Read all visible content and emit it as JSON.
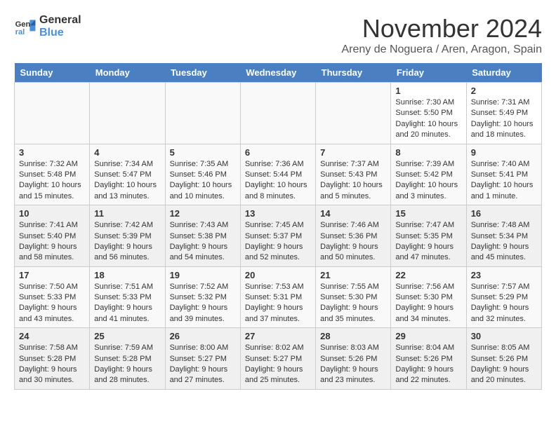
{
  "header": {
    "logo_line1": "General",
    "logo_line2": "Blue",
    "month": "November 2024",
    "location": "Areny de Noguera / Aren, Aragon, Spain"
  },
  "weekdays": [
    "Sunday",
    "Monday",
    "Tuesday",
    "Wednesday",
    "Thursday",
    "Friday",
    "Saturday"
  ],
  "weeks": [
    [
      {
        "day": "",
        "info": ""
      },
      {
        "day": "",
        "info": ""
      },
      {
        "day": "",
        "info": ""
      },
      {
        "day": "",
        "info": ""
      },
      {
        "day": "",
        "info": ""
      },
      {
        "day": "1",
        "info": "Sunrise: 7:30 AM\nSunset: 5:50 PM\nDaylight: 10 hours and 20 minutes."
      },
      {
        "day": "2",
        "info": "Sunrise: 7:31 AM\nSunset: 5:49 PM\nDaylight: 10 hours and 18 minutes."
      }
    ],
    [
      {
        "day": "3",
        "info": "Sunrise: 7:32 AM\nSunset: 5:48 PM\nDaylight: 10 hours and 15 minutes."
      },
      {
        "day": "4",
        "info": "Sunrise: 7:34 AM\nSunset: 5:47 PM\nDaylight: 10 hours and 13 minutes."
      },
      {
        "day": "5",
        "info": "Sunrise: 7:35 AM\nSunset: 5:46 PM\nDaylight: 10 hours and 10 minutes."
      },
      {
        "day": "6",
        "info": "Sunrise: 7:36 AM\nSunset: 5:44 PM\nDaylight: 10 hours and 8 minutes."
      },
      {
        "day": "7",
        "info": "Sunrise: 7:37 AM\nSunset: 5:43 PM\nDaylight: 10 hours and 5 minutes."
      },
      {
        "day": "8",
        "info": "Sunrise: 7:39 AM\nSunset: 5:42 PM\nDaylight: 10 hours and 3 minutes."
      },
      {
        "day": "9",
        "info": "Sunrise: 7:40 AM\nSunset: 5:41 PM\nDaylight: 10 hours and 1 minute."
      }
    ],
    [
      {
        "day": "10",
        "info": "Sunrise: 7:41 AM\nSunset: 5:40 PM\nDaylight: 9 hours and 58 minutes."
      },
      {
        "day": "11",
        "info": "Sunrise: 7:42 AM\nSunset: 5:39 PM\nDaylight: 9 hours and 56 minutes."
      },
      {
        "day": "12",
        "info": "Sunrise: 7:43 AM\nSunset: 5:38 PM\nDaylight: 9 hours and 54 minutes."
      },
      {
        "day": "13",
        "info": "Sunrise: 7:45 AM\nSunset: 5:37 PM\nDaylight: 9 hours and 52 minutes."
      },
      {
        "day": "14",
        "info": "Sunrise: 7:46 AM\nSunset: 5:36 PM\nDaylight: 9 hours and 50 minutes."
      },
      {
        "day": "15",
        "info": "Sunrise: 7:47 AM\nSunset: 5:35 PM\nDaylight: 9 hours and 47 minutes."
      },
      {
        "day": "16",
        "info": "Sunrise: 7:48 AM\nSunset: 5:34 PM\nDaylight: 9 hours and 45 minutes."
      }
    ],
    [
      {
        "day": "17",
        "info": "Sunrise: 7:50 AM\nSunset: 5:33 PM\nDaylight: 9 hours and 43 minutes."
      },
      {
        "day": "18",
        "info": "Sunrise: 7:51 AM\nSunset: 5:33 PM\nDaylight: 9 hours and 41 minutes."
      },
      {
        "day": "19",
        "info": "Sunrise: 7:52 AM\nSunset: 5:32 PM\nDaylight: 9 hours and 39 minutes."
      },
      {
        "day": "20",
        "info": "Sunrise: 7:53 AM\nSunset: 5:31 PM\nDaylight: 9 hours and 37 minutes."
      },
      {
        "day": "21",
        "info": "Sunrise: 7:55 AM\nSunset: 5:30 PM\nDaylight: 9 hours and 35 minutes."
      },
      {
        "day": "22",
        "info": "Sunrise: 7:56 AM\nSunset: 5:30 PM\nDaylight: 9 hours and 34 minutes."
      },
      {
        "day": "23",
        "info": "Sunrise: 7:57 AM\nSunset: 5:29 PM\nDaylight: 9 hours and 32 minutes."
      }
    ],
    [
      {
        "day": "24",
        "info": "Sunrise: 7:58 AM\nSunset: 5:28 PM\nDaylight: 9 hours and 30 minutes."
      },
      {
        "day": "25",
        "info": "Sunrise: 7:59 AM\nSunset: 5:28 PM\nDaylight: 9 hours and 28 minutes."
      },
      {
        "day": "26",
        "info": "Sunrise: 8:00 AM\nSunset: 5:27 PM\nDaylight: 9 hours and 27 minutes."
      },
      {
        "day": "27",
        "info": "Sunrise: 8:02 AM\nSunset: 5:27 PM\nDaylight: 9 hours and 25 minutes."
      },
      {
        "day": "28",
        "info": "Sunrise: 8:03 AM\nSunset: 5:26 PM\nDaylight: 9 hours and 23 minutes."
      },
      {
        "day": "29",
        "info": "Sunrise: 8:04 AM\nSunset: 5:26 PM\nDaylight: 9 hours and 22 minutes."
      },
      {
        "day": "30",
        "info": "Sunrise: 8:05 AM\nSunset: 5:26 PM\nDaylight: 9 hours and 20 minutes."
      }
    ]
  ]
}
